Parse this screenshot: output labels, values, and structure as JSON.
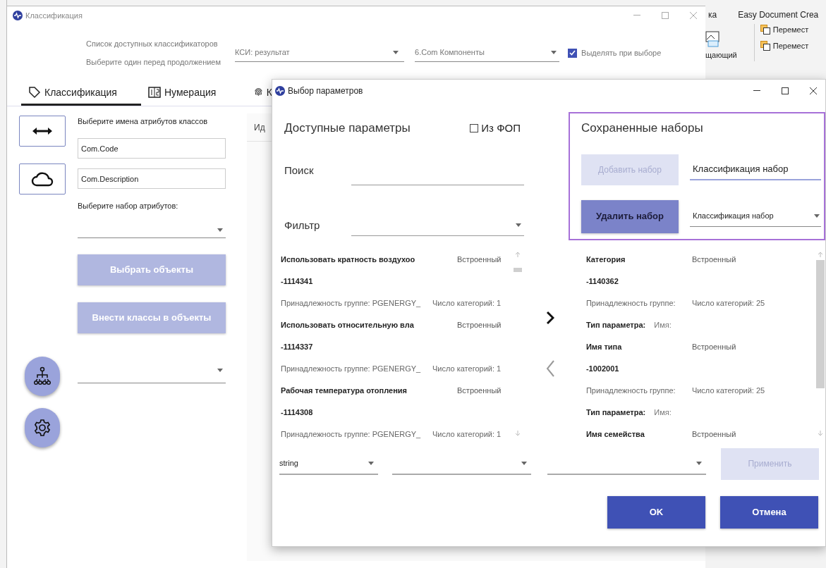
{
  "background_app": {
    "ribbon_tabs": [
      "ка",
      "Easy Document Crea"
    ],
    "ribbon_items": [
      "Перемест",
      "Перемест"
    ],
    "ribbon_label": "щающий"
  },
  "main_window": {
    "title": "Классификация",
    "header_labels": [
      "Список доступных классификаторов",
      "Выберите один перед продолжением"
    ],
    "classifier_dropdown": {
      "value": "КСИ: результат"
    },
    "component_dropdown": {
      "value": "6.Com Компоненты"
    },
    "highlight_checkbox": {
      "label": "Выделять при выборе",
      "checked": true
    },
    "tabs": [
      {
        "label": "Классификация",
        "selected": true
      },
      {
        "label": "Нумерация",
        "selected": false
      },
      {
        "label": "К",
        "selected": false
      }
    ],
    "attributes_label": "Выберите имена атрибутов классов",
    "attribute_fields": [
      "Com.Code",
      "Com.Description"
    ],
    "attribute_set_label": "Выберите набор атрибутов:",
    "action_buttons": [
      {
        "label": "Выбрать объекты",
        "disabled": true
      },
      {
        "label": "Внести классы в объекты",
        "disabled": true
      }
    ],
    "content_header": "Ид"
  },
  "dialog": {
    "title": "Выбор параметров",
    "available_title": "Доступные параметры",
    "fop_checkbox": {
      "label": "Из ФОП",
      "checked": false
    },
    "search_label": "Поиск",
    "filter_label": "Фильтр",
    "available_params": [
      {
        "name": "Использовать кратность воздухоо",
        "source": "Встроенный",
        "code": "-1114341",
        "group": "Принадлежность группе: PGENERGY_",
        "categories": "Число категорий: 1"
      },
      {
        "name": "Использовать относительную вла",
        "source": "Встроенный",
        "code": "-1114337",
        "group": "Принадлежность группе: PGENERGY_",
        "categories": "Число категорий: 1"
      },
      {
        "name": "Рабочая температура отопления",
        "source": "Встроенный",
        "code": "-1114308",
        "group": "Принадлежность группе: PGENERGY_",
        "categories": "Число категорий: 1"
      }
    ],
    "saved_sets": {
      "title": "Сохраненные наборы",
      "add_button": {
        "label": "Добавить набор",
        "disabled": true
      },
      "name_field": {
        "value": "Классификация набор"
      },
      "delete_button": {
        "label": "Удалить набор",
        "disabled": false
      },
      "set_dropdown": {
        "value": "Классификация набор"
      }
    },
    "selected_params": [
      {
        "name": "Категория",
        "source": "Встроенный",
        "code": "-1140362",
        "group": "Принадлежность группе:",
        "categories": "Число категорий: 25",
        "type_label": "Тип параметра:",
        "type_value": "Имя:"
      },
      {
        "name": "Имя типа",
        "source": "Встроенный",
        "code": "-1002001",
        "group": "Принадлежность группе:",
        "categories": "Число категорий: 25",
        "type_label": "Тип параметра:",
        "type_value": "Имя:"
      },
      {
        "name": "Имя семейства",
        "source": "Встроенный"
      }
    ],
    "type_dropdown": {
      "value": "string"
    },
    "apply_button": {
      "label": "Применить",
      "disabled": true
    },
    "ok_button": {
      "label": "OK"
    },
    "cancel_button": {
      "label": "Отмена"
    }
  }
}
